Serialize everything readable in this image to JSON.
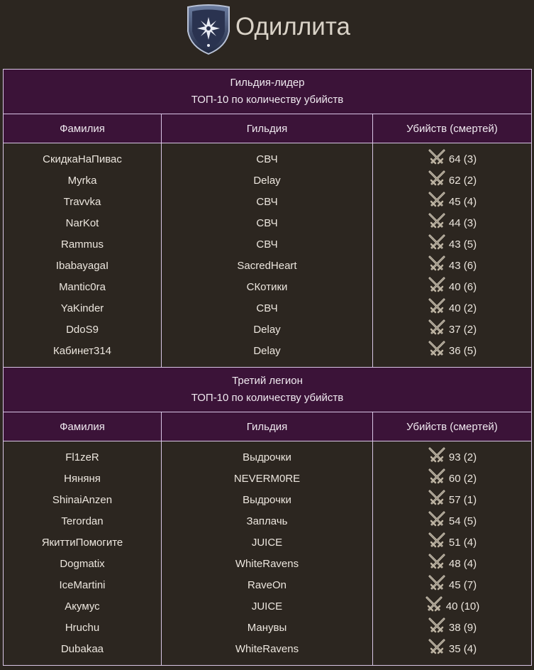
{
  "header": {
    "title": "Одиллита",
    "emblem_icon": "guild-crest-icon"
  },
  "sections": [
    {
      "title": "Гильдия-лидер",
      "subtitle": "ТОП-10 по количеству убийств",
      "columns": [
        "Фамилия",
        "Гильдия",
        "Убийств (смертей)"
      ],
      "rows": [
        {
          "name": "СкидкаНаПивас",
          "guild": "СВЧ",
          "score": "64 (3)"
        },
        {
          "name": "Myrka",
          "guild": "Delay",
          "score": "62 (2)"
        },
        {
          "name": "Travvka",
          "guild": "СВЧ",
          "score": "45 (4)"
        },
        {
          "name": "NarKot",
          "guild": "СВЧ",
          "score": "44 (3)"
        },
        {
          "name": "Rammus",
          "guild": "СВЧ",
          "score": "43 (5)"
        },
        {
          "name": "IbabayagaI",
          "guild": "SacredHeart",
          "score": "43 (6)"
        },
        {
          "name": "Mantic0ra",
          "guild": "СКотики",
          "score": "40 (6)"
        },
        {
          "name": "YaKinder",
          "guild": "СВЧ",
          "score": "40 (2)"
        },
        {
          "name": "DdoS9",
          "guild": "Delay",
          "score": "37 (2)"
        },
        {
          "name": "Кабинет314",
          "guild": "Delay",
          "score": "36 (5)"
        }
      ]
    },
    {
      "title": "Третий легион",
      "subtitle": "ТОП-10 по количеству убийств",
      "columns": [
        "Фамилия",
        "Гильдия",
        "Убийств (смертей)"
      ],
      "rows": [
        {
          "name": "Fl1zeR",
          "guild": "Выдрочки",
          "score": "93 (2)"
        },
        {
          "name": "Няняня",
          "guild": "NEVERM0RE",
          "score": "60 (2)"
        },
        {
          "name": "ShinaiAnzen",
          "guild": "Выдрочки",
          "score": "57 (1)"
        },
        {
          "name": "Terordan",
          "guild": "Заплачь",
          "score": "54 (5)"
        },
        {
          "name": "ЯкиттиПомогите",
          "guild": "JUICE",
          "score": "51 (4)"
        },
        {
          "name": "Dogmatix",
          "guild": "WhiteRavens",
          "score": "48 (4)"
        },
        {
          "name": "IceMartini",
          "guild": "RaveOn",
          "score": "45 (7)"
        },
        {
          "name": "Акумус",
          "guild": "JUICE",
          "score": "40 (10)"
        },
        {
          "name": "Hruchu",
          "guild": "Манувы",
          "score": "38 (9)"
        },
        {
          "name": "Dubakaa",
          "guild": "WhiteRavens",
          "score": "35 (4)"
        }
      ]
    }
  ],
  "icons": {
    "kills": "crossed-swords-icon"
  },
  "colors": {
    "background": "#2c2620",
    "header_bg": "#3b1338",
    "border": "#d9c6e6"
  }
}
